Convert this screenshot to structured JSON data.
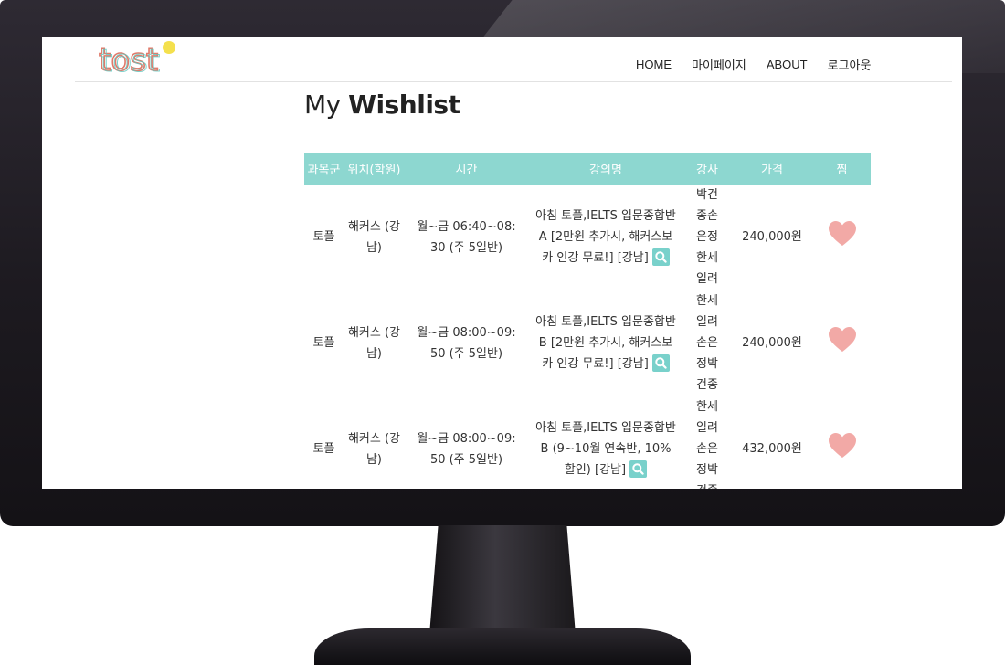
{
  "header": {
    "logo_text": "tost",
    "nav": [
      "HOME",
      "마이페이지",
      "ABOUT",
      "로그아웃"
    ]
  },
  "title": {
    "light": "My",
    "bold": "Wishlist"
  },
  "table": {
    "headers": [
      "과목군",
      "위치(학원)",
      "시간",
      "강의명",
      "강사",
      "가격",
      "찜"
    ],
    "rows": [
      {
        "subject": "토플",
        "location": "해커스 (강남)",
        "time": "월~금 06:40~08:30 (주 5일반)",
        "course": "아침 토플,IELTS 입문종합반 A [2만원 추가시, 해커스보카 인강 무료!] [강남]",
        "teacher": "박건종손은정한세일려",
        "price": "240,000원"
      },
      {
        "subject": "토플",
        "location": "해커스 (강남)",
        "time": "월~금 08:00~09:50 (주 5일반)",
        "course": "아침 토플,IELTS 입문종합반 B [2만원 추가시, 해커스보카 인강 무료!] [강남]",
        "teacher": "한세일려손은정박건종",
        "price": "240,000원"
      },
      {
        "subject": "토플",
        "location": "해커스 (강남)",
        "time": "월~금 08:00~09:50 (주 5일반)",
        "course": "아침 토플,IELTS 입문종합반 B (9~10월 연속반, 10% 할인) [강남]",
        "teacher": "한세일려손은정박건종",
        "price": "432,000원"
      }
    ]
  },
  "colors": {
    "header_bg": "#8dd7d0",
    "row_border": "#9ad8d2",
    "heart": "#f2a9a6",
    "search_btn": "#79d1cb"
  }
}
